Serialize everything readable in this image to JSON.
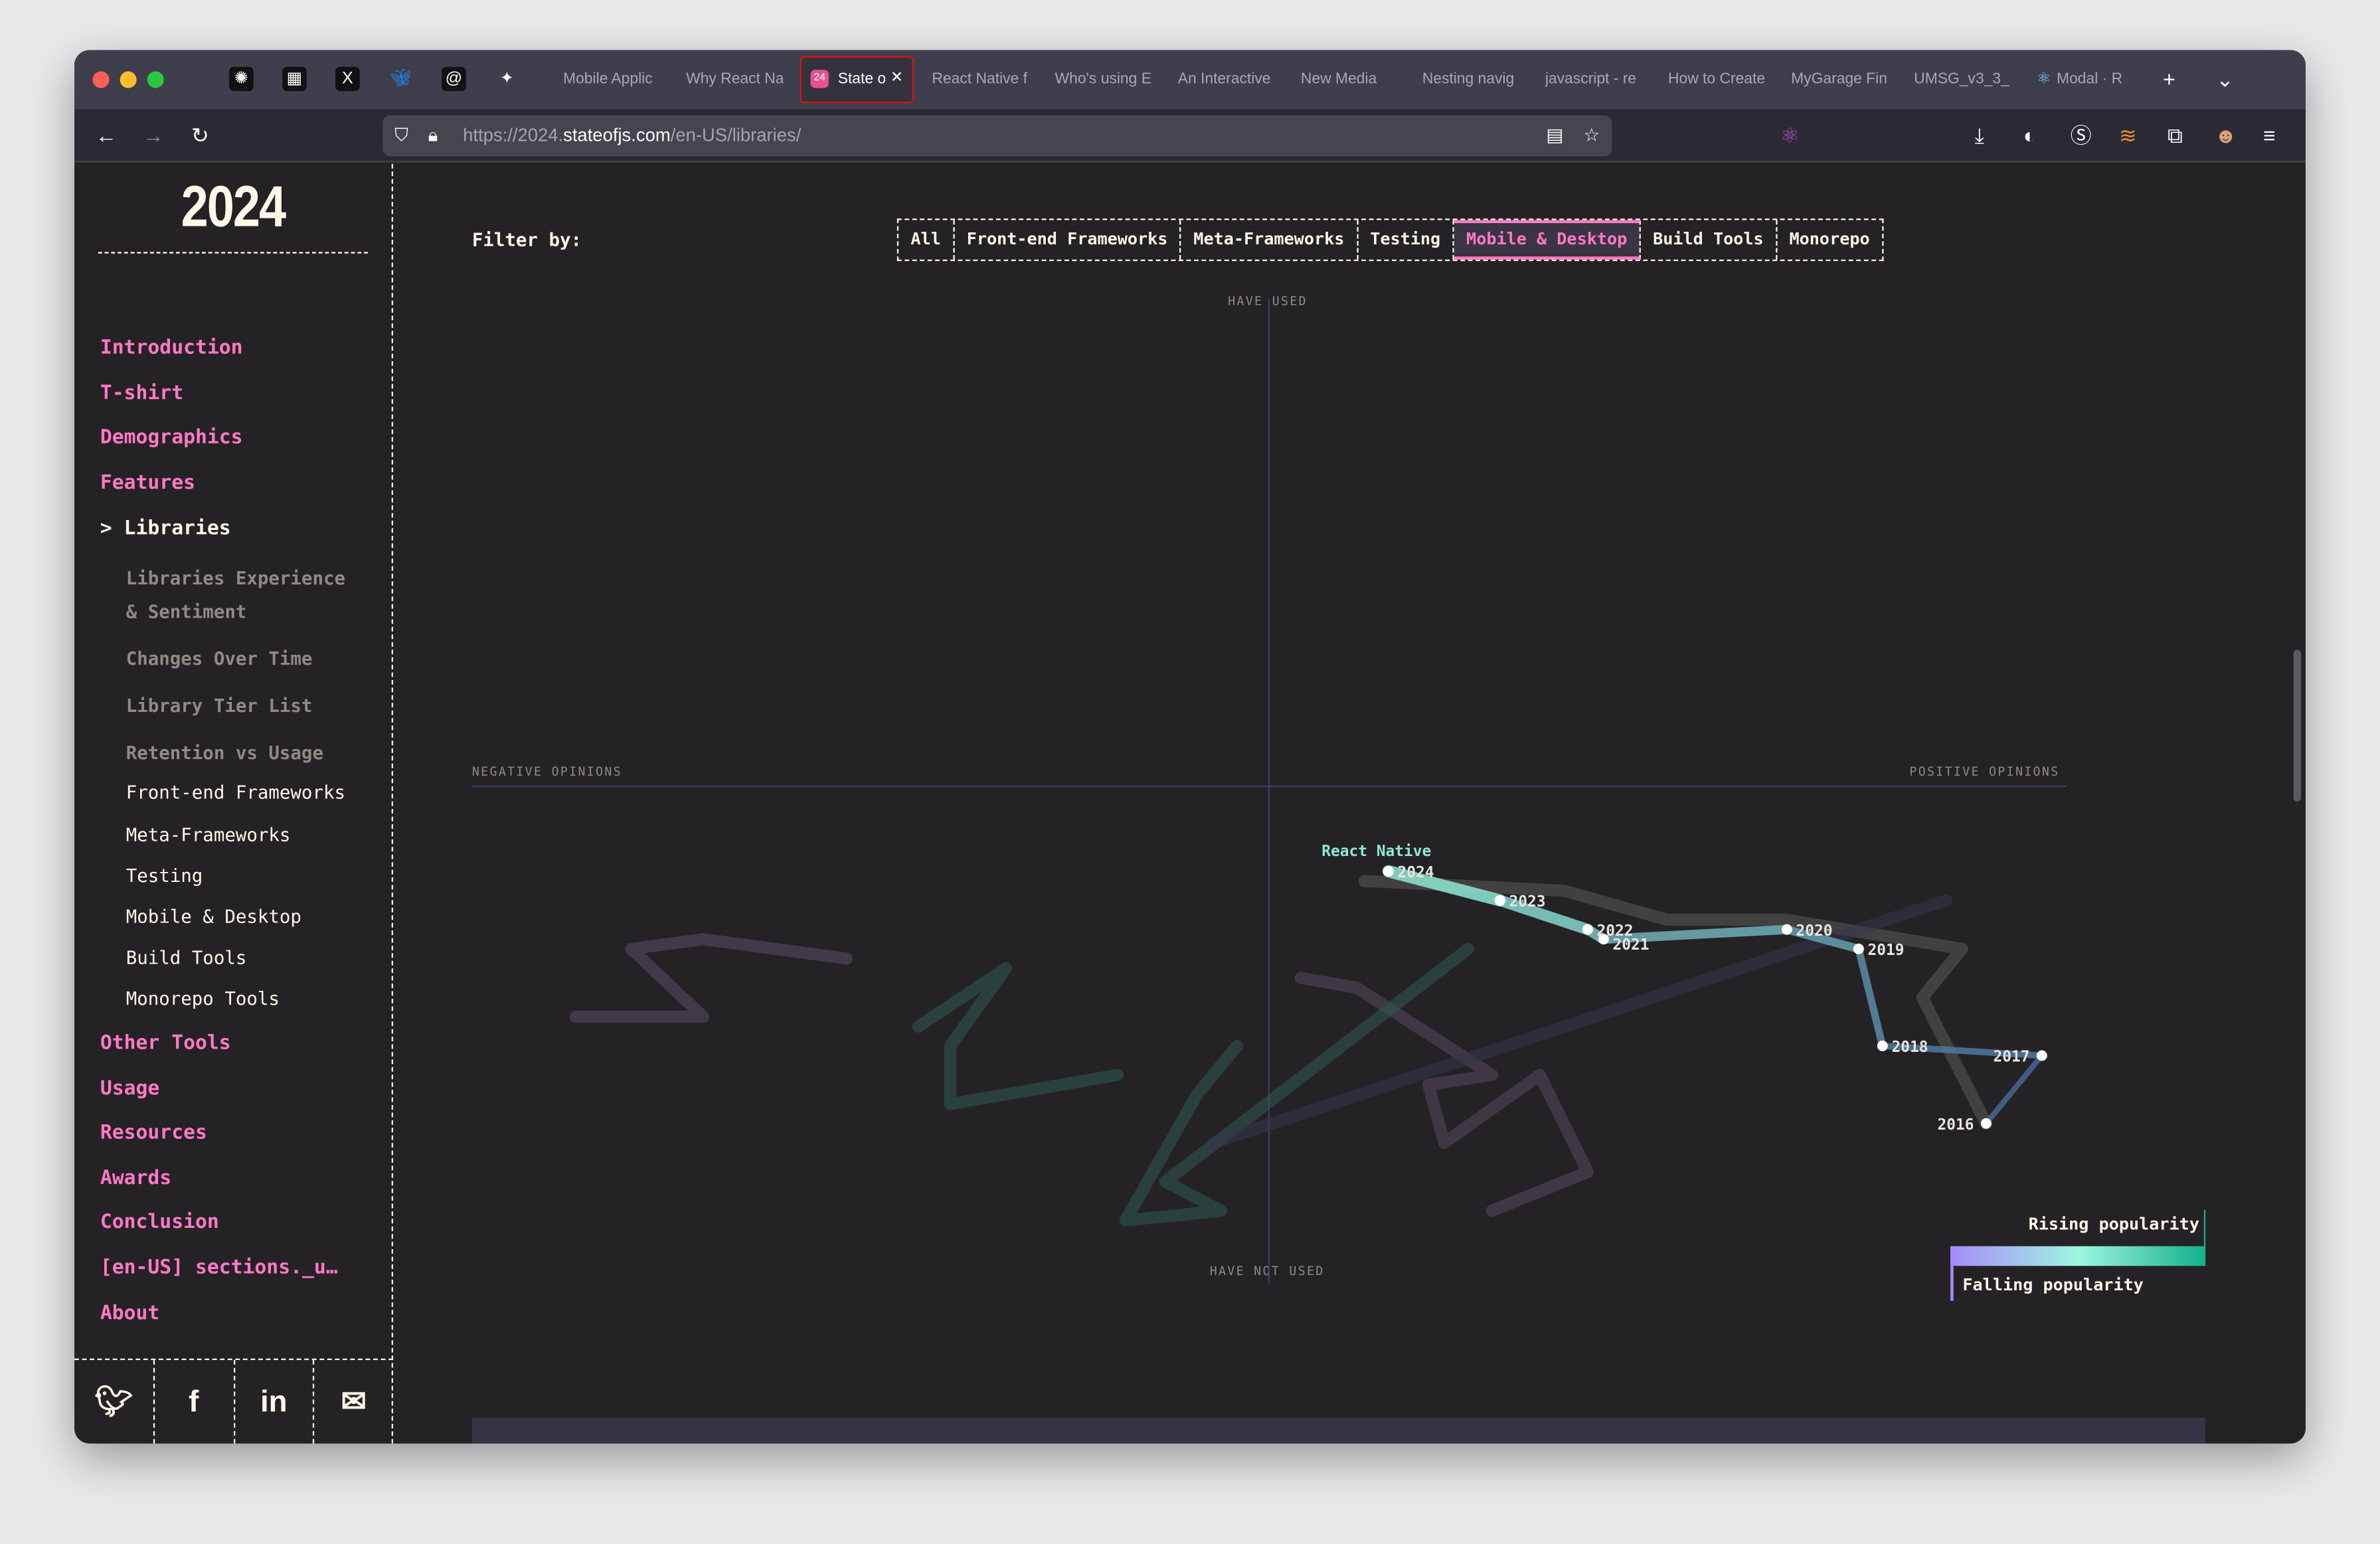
{
  "browser": {
    "pinned_tabs": [
      "chatgpt-icon",
      "clapper-icon",
      "x-icon",
      "bluesky-icon",
      "threads-icon",
      "pin-icon"
    ],
    "tabs": [
      {
        "label": "Mobile Applic"
      },
      {
        "label": "Why React Na"
      },
      {
        "label": "State o",
        "active": true,
        "badge": "24"
      },
      {
        "label": "React Native f"
      },
      {
        "label": "Who's using E"
      },
      {
        "label": "An Interactive"
      },
      {
        "label": "New Media"
      },
      {
        "label": "Nesting navig"
      },
      {
        "label": "javascript - re"
      },
      {
        "label": "How to Create"
      },
      {
        "label": "MyGarage Fin"
      },
      {
        "label": "UMSG_v3_3_"
      },
      {
        "label": "Modal · R"
      }
    ],
    "url_prefix": "https://2024.",
    "url_domain": "stateofjs.com",
    "url_path": "/en-US/libraries/"
  },
  "sidebar": {
    "logo": "2024",
    "items": [
      {
        "label": "Introduction"
      },
      {
        "label": "T-shirt"
      },
      {
        "label": "Demographics"
      },
      {
        "label": "Features"
      },
      {
        "label": "> Libraries"
      },
      {
        "label": "Libraries Experience"
      },
      {
        "label": "& Sentiment"
      },
      {
        "label": "Changes Over Time"
      },
      {
        "label": "Library Tier List"
      },
      {
        "label": "Retention vs Usage"
      },
      {
        "label": "Front-end Frameworks"
      },
      {
        "label": "Meta-Frameworks"
      },
      {
        "label": "Testing"
      },
      {
        "label": "Mobile & Desktop"
      },
      {
        "label": "Build Tools"
      },
      {
        "label": "Monorepo Tools"
      },
      {
        "label": "Other Tools"
      },
      {
        "label": "Usage"
      },
      {
        "label": "Resources"
      },
      {
        "label": "Awards"
      },
      {
        "label": "Conclusion"
      },
      {
        "label": "[en-US] sections._u…"
      },
      {
        "label": "About"
      }
    ],
    "social": [
      "twitter-icon",
      "facebook-icon",
      "linkedin-icon",
      "email-icon"
    ]
  },
  "filter": {
    "label": "Filter by:",
    "options": [
      "All",
      "Front-end Frameworks",
      "Meta-Frameworks",
      "Testing",
      "Mobile & Desktop",
      "Build Tools",
      "Monorepo"
    ],
    "selected": "Mobile & Desktop"
  },
  "chart_data": {
    "type": "line",
    "axis_labels": {
      "top": "HAVE USED",
      "bottom": "HAVE NOT USED",
      "left": "NEGATIVE OPINIONS",
      "right": "POSITIVE OPINIONS"
    },
    "xlim": [
      -100,
      100
    ],
    "ylim": [
      0,
      100
    ],
    "highlight": {
      "name": "React Native",
      "color": "#8ee8d5",
      "points": [
        {
          "year": "2016",
          "x": 90,
          "y": 15
        },
        {
          "year": "2017",
          "x": 97,
          "y": 22
        },
        {
          "year": "2018",
          "x": 77,
          "y": 23
        },
        {
          "year": "2019",
          "x": 74,
          "y": 33
        },
        {
          "year": "2020",
          "x": 65,
          "y": 35
        },
        {
          "year": "2021",
          "x": 42,
          "y": 34
        },
        {
          "year": "2022",
          "x": 40,
          "y": 35
        },
        {
          "year": "2023",
          "x": 29,
          "y": 38
        },
        {
          "year": "2024",
          "x": 15,
          "y": 41
        }
      ]
    },
    "background_series": [
      {
        "color": "#5c5a58",
        "points": [
          [
            12,
            40
          ],
          [
            37,
            39
          ],
          [
            50,
            36
          ],
          [
            65,
            36
          ],
          [
            87,
            33
          ],
          [
            82,
            28
          ],
          [
            90,
            15
          ]
        ]
      },
      {
        "color": "#5a4b66",
        "points": [
          [
            -87,
            26
          ],
          [
            -71,
            26
          ],
          [
            -80,
            33
          ],
          [
            -71,
            34
          ],
          [
            -53,
            32
          ]
        ]
      },
      {
        "color": "#2f5a50",
        "points": [
          [
            -44,
            25
          ],
          [
            -33,
            31
          ],
          [
            -40,
            23
          ],
          [
            -40,
            17
          ],
          [
            -19,
            20
          ]
        ]
      },
      {
        "color": "#56485f",
        "points": [
          [
            4,
            30
          ],
          [
            11,
            29
          ],
          [
            28,
            20
          ],
          [
            20,
            19
          ],
          [
            22,
            13
          ],
          [
            34,
            20
          ],
          [
            40,
            10
          ],
          [
            28,
            6
          ]
        ]
      },
      {
        "color": "#2e5a52",
        "points": [
          [
            -4,
            23
          ],
          [
            -9,
            18
          ],
          [
            -18,
            5
          ],
          [
            -6,
            6
          ],
          [
            -13,
            9
          ],
          [
            25,
            33
          ]
        ]
      },
      {
        "color": "#35354f",
        "points": [
          [
            -7,
            13
          ],
          [
            85,
            38
          ]
        ]
      }
    ],
    "legend": {
      "rising": "Rising popularity",
      "falling": "Falling popularity",
      "gradient": [
        "#a78bfa",
        "#9ef5e0",
        "#14b08a"
      ]
    }
  }
}
